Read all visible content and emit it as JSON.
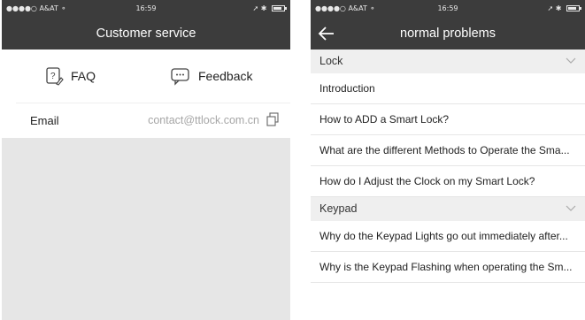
{
  "left": {
    "status": {
      "carrier": "A&AT",
      "time": "16:59"
    },
    "title": "Customer service",
    "tabs": {
      "faq": "FAQ",
      "feedback": "Feedback"
    },
    "email": {
      "label": "Email",
      "value": "contact@ttlock.com.cn"
    }
  },
  "right": {
    "status": {
      "carrier": "A&AT",
      "time": "16:59"
    },
    "title": "normal problems",
    "sections": [
      {
        "name": "Lock",
        "items": [
          "Introduction",
          "How to ADD a Smart Lock?",
          "What are the different Methods to Operate the Sma...",
          "How do I Adjust the Clock on my Smart Lock?"
        ]
      },
      {
        "name": "Keypad",
        "items": [
          "Why do the Keypad Lights go out immediately after...",
          "Why is the Keypad Flashing when operating the Sm..."
        ]
      }
    ]
  },
  "colors": {
    "header": "#3c3c3c",
    "section": "#efefef",
    "background": "#e6e6e6"
  }
}
